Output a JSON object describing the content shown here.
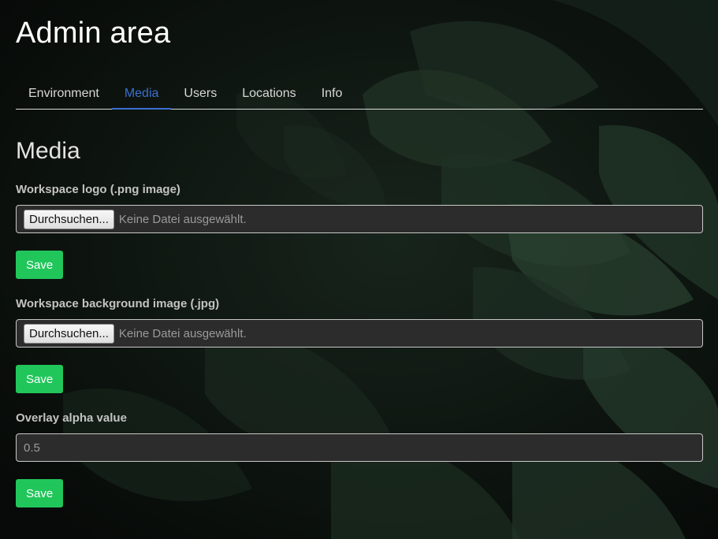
{
  "page_title": "Admin area",
  "tabs": [
    {
      "label": "Environment",
      "active": false
    },
    {
      "label": "Media",
      "active": true
    },
    {
      "label": "Users",
      "active": false
    },
    {
      "label": "Locations",
      "active": false
    },
    {
      "label": "Info",
      "active": false
    }
  ],
  "section_title": "Media",
  "logo": {
    "label": "Workspace logo (.png image)",
    "browse_label": "Durchsuchen...",
    "status": "Keine Datei ausgewählt.",
    "save_label": "Save"
  },
  "background": {
    "label": "Workspace background image (.jpg)",
    "browse_label": "Durchsuchen...",
    "status": "Keine Datei ausgewählt.",
    "save_label": "Save"
  },
  "overlay": {
    "label": "Overlay alpha value",
    "value": "0.5",
    "save_label": "Save"
  },
  "colors": {
    "accent": "#3b6fd1",
    "save": "#21c65b",
    "background": "#0b100d"
  }
}
